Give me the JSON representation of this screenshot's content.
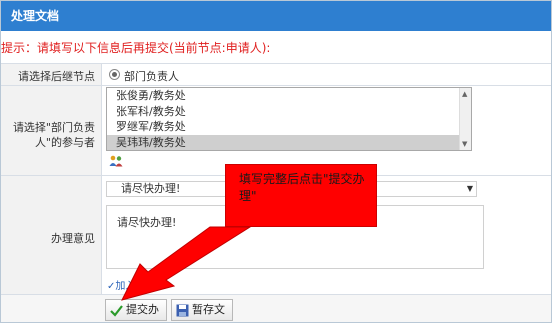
{
  "dialog": {
    "title": "处理文档",
    "close_glyph": "×",
    "hint": "提示：请填写以下信息后再提交(当前节点:申请人):"
  },
  "next_node": {
    "label": "请选择后继节点",
    "option": "部门负责人"
  },
  "participants": {
    "label_line1": "请选择\"部门负责",
    "label_line2": "人\"的参与者",
    "options": [
      {
        "text": "张俊勇/教务处",
        "selected": false
      },
      {
        "text": "张军科/教务处",
        "selected": false
      },
      {
        "text": "罗继军/教务处",
        "selected": false
      },
      {
        "text": "吴玮玮/教务处",
        "selected": true
      }
    ]
  },
  "opinion": {
    "label": "办理意见",
    "select_value": "请尽快办理!",
    "textarea_value": "请尽快办理!",
    "add_link": "✓加入到常"
  },
  "buttons": {
    "submit": "提交办理",
    "save_draft": "暂存文档"
  },
  "callout": {
    "text": "填写完整后点击\"提交办理\""
  },
  "colors": {
    "titlebar": "#2e7fd0",
    "hint": "#e02020",
    "callout": "#ff0000"
  }
}
